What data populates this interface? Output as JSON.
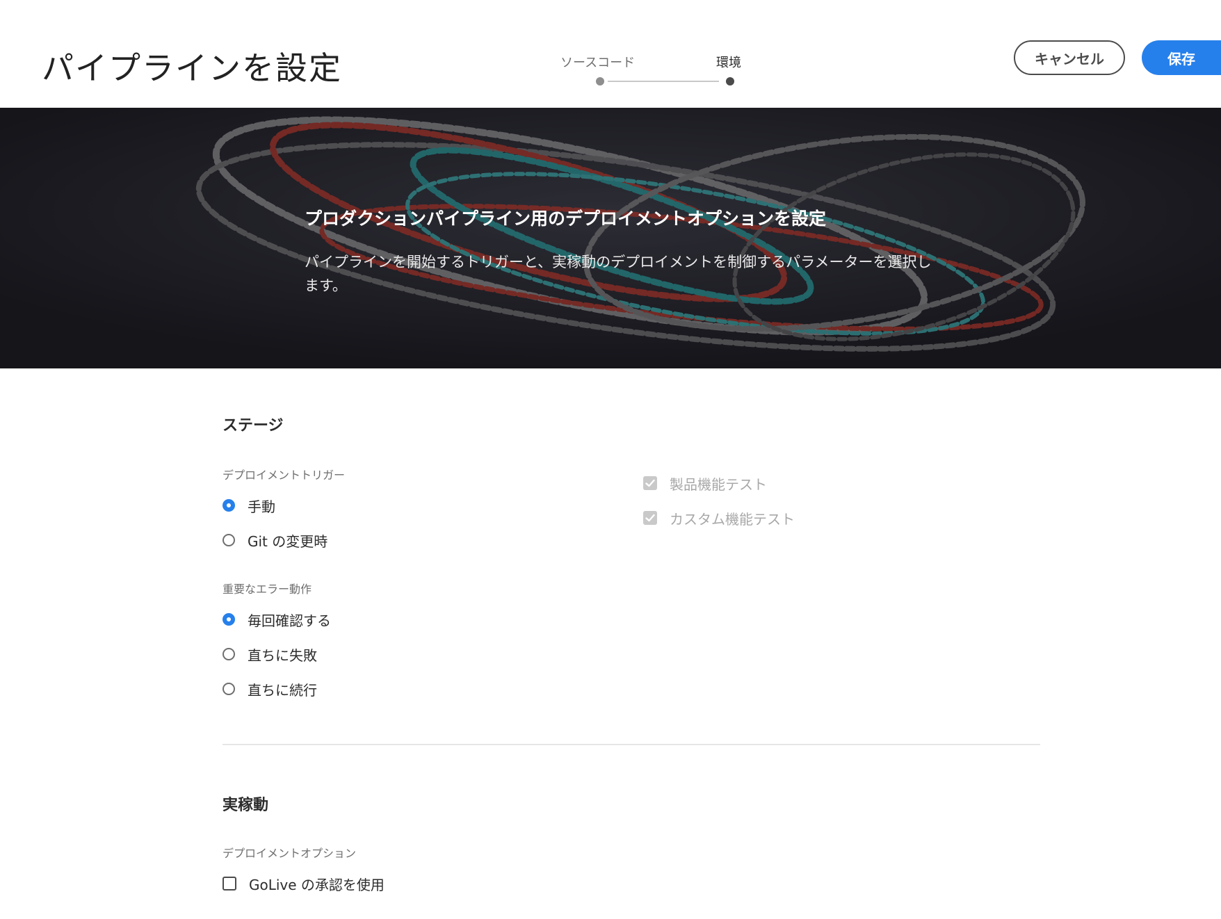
{
  "header": {
    "title": "パイプラインを設定",
    "steps": [
      {
        "label": "ソースコード",
        "state": "completed",
        "color": "#8e8e8e"
      },
      {
        "label": "環境",
        "state": "current",
        "color": "#4b4b4b"
      }
    ],
    "cancel_label": "キャンセル",
    "save_label": "保存",
    "accent_color": "#2680eb"
  },
  "hero": {
    "title": "プロダクションパイプライン用のデプロイメントオプションを設定",
    "description": "パイプラインを開始するトリガーと、実稼動のデプロイメントを制御するパラメーターを選択します。"
  },
  "stage": {
    "title": "ステージ",
    "trigger": {
      "label": "デプロイメントトリガー",
      "options": [
        {
          "label": "手動",
          "checked": true
        },
        {
          "label": "Git の変更時",
          "checked": false
        }
      ]
    },
    "error_behavior": {
      "label": "重要なエラー動作",
      "options": [
        {
          "label": "毎回確認する",
          "checked": true
        },
        {
          "label": "直ちに失敗",
          "checked": false
        },
        {
          "label": "直ちに続行",
          "checked": false
        }
      ]
    },
    "tests": [
      {
        "label": "製品機能テスト",
        "checked": true,
        "disabled": true
      },
      {
        "label": "カスタム機能テスト",
        "checked": true,
        "disabled": true
      }
    ]
  },
  "production": {
    "title": "実稼動",
    "deploy_options": {
      "label": "デプロイメントオプション",
      "options": [
        {
          "label": "GoLive の承認を使用",
          "checked": false
        }
      ]
    }
  }
}
